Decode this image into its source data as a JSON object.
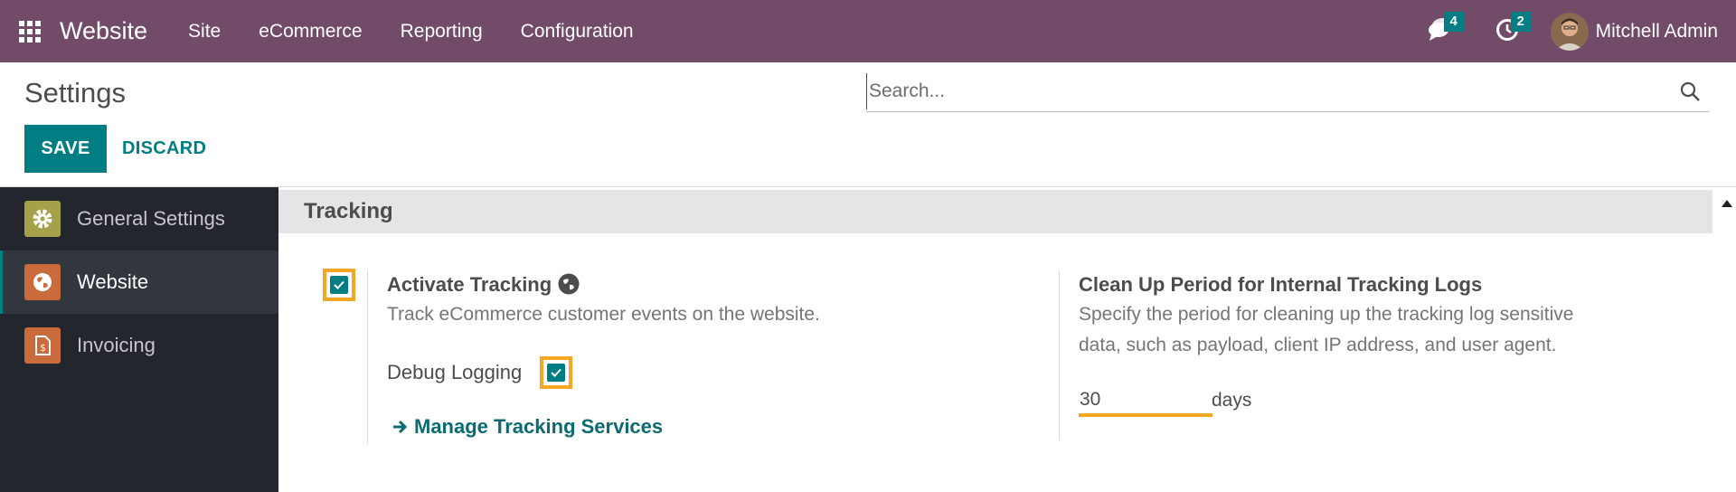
{
  "navbar": {
    "brand": "Website",
    "menus": [
      "Site",
      "eCommerce",
      "Reporting",
      "Configuration"
    ],
    "messages_count": "4",
    "activities_count": "2",
    "user_name": "Mitchell Admin"
  },
  "control_panel": {
    "title": "Settings",
    "save_label": "SAVE",
    "discard_label": "DISCARD",
    "search_placeholder": "Search..."
  },
  "sidebar": {
    "items": [
      {
        "label": "General Settings",
        "icon": "gear-icon",
        "color": "#a5a14a"
      },
      {
        "label": "Website",
        "icon": "globe-icon",
        "color": "#c96b3d"
      },
      {
        "label": "Invoicing",
        "icon": "invoice-icon",
        "color": "#c96b3d"
      }
    ]
  },
  "section": {
    "title": "Tracking",
    "activate_tracking": {
      "title": "Activate Tracking",
      "description": "Track eCommerce customer events on the website.",
      "checked": true
    },
    "debug_logging": {
      "label": "Debug Logging",
      "checked": true
    },
    "manage_link": "Manage Tracking Services",
    "cleanup": {
      "title": "Clean Up Period for Internal Tracking Logs",
      "description_line1": "Specify the period for cleaning up the tracking log sensitive",
      "description_line2": "data, such as payload, client IP address, and user agent.",
      "value": "30",
      "unit": "days"
    }
  },
  "colors": {
    "navbar": "#714b67",
    "primary": "#017e84",
    "highlight": "#f5a623",
    "sidebar": "#23262d"
  }
}
